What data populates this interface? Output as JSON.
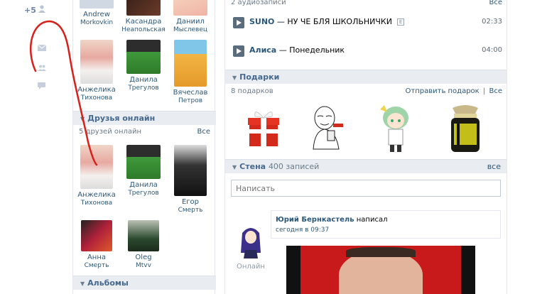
{
  "sidebar": {
    "notif_badge": "+5"
  },
  "friends": [
    {
      "first": "Andrew",
      "last": "Morkovkin",
      "color": "#cfd8e3"
    },
    {
      "first": "Касандра",
      "last": "Неапольская",
      "color": "#4a2a20"
    },
    {
      "first": "Даниил",
      "last": "Мыслевец",
      "color": "#f1c9a8"
    },
    {
      "first": "Анжелика",
      "last": "Тихонова",
      "color": "#e2b3a2"
    },
    {
      "first": "Данила",
      "last": "Трегулов",
      "color": "#3b8a3a"
    },
    {
      "first": "Вячеслав",
      "last": "Петров",
      "color": "#f0b64a"
    }
  ],
  "friends_online": {
    "title": "Друзья онлайн",
    "count_text": "5 друзей онлайн",
    "all_label": "Все",
    "items": [
      {
        "first": "Анжелика",
        "last": "Тихонова",
        "color": "#e2b3a2"
      },
      {
        "first": "Данила",
        "last": "Трегулов",
        "color": "#3b8a3a"
      },
      {
        "first": "Егор",
        "last": "Смерть",
        "color": "#2a2a2a"
      },
      {
        "first": "Анна",
        "last": "Смерть",
        "color": "#b0213a"
      },
      {
        "first": "Oleg",
        "last": "Mtvv",
        "color": "#2a4a2e"
      }
    ]
  },
  "albums": {
    "title": "Альбомы"
  },
  "audio": {
    "count_text": "2 аудиозаписи",
    "all_label": "Все",
    "tracks": [
      {
        "artist": "SUNO",
        "sep": " — ",
        "title": "НУ ЧЕ БЛЯ ШКОЛЬНИЧКИ",
        "explicit": "E",
        "duration": "02:33"
      },
      {
        "artist": "Алиса",
        "sep": " — ",
        "title": "Понедельник",
        "explicit": "",
        "duration": "04:00"
      }
    ]
  },
  "gifts": {
    "title": "Подарки",
    "count_text": "8 подарков",
    "send_label": "Отправить подарок",
    "separator": "|",
    "all_label": "Все"
  },
  "wall": {
    "title": "Стена",
    "count_text": "400 записей",
    "all_label": "все",
    "input_placeholder": "Написать",
    "post": {
      "author": "Юрий Бернкастель",
      "verb": "написал",
      "time": "сегодня в 09:37",
      "status": "Онлайн"
    }
  },
  "annotation_color": "#d8201a"
}
